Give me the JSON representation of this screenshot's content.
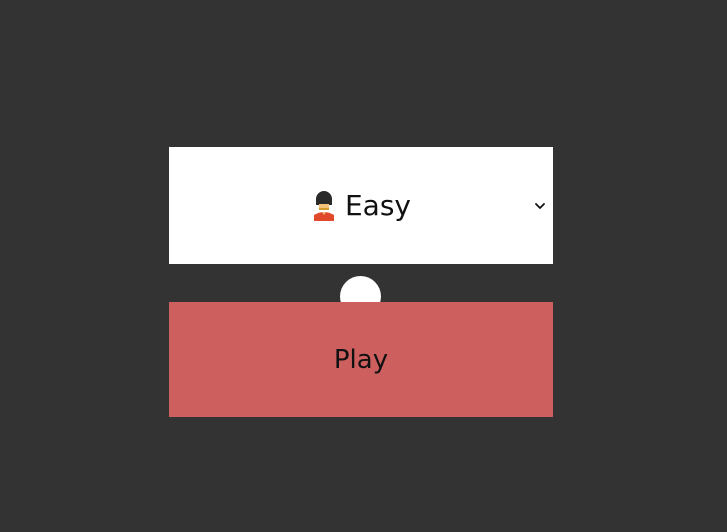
{
  "colors": {
    "background": "#333333",
    "select_bg": "#ffffff",
    "play_bg": "#cd5f5f",
    "text": "#111111"
  },
  "difficulty": {
    "icon": "royal-guard-icon",
    "selected_label": "Easy"
  },
  "play": {
    "label": "Play"
  }
}
